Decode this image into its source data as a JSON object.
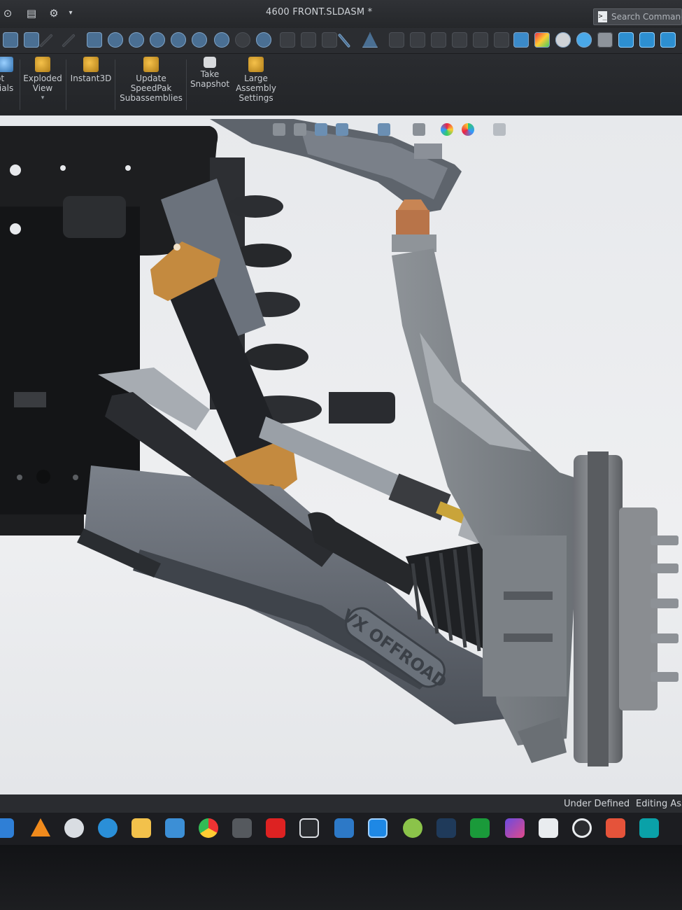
{
  "window": {
    "title": "4600 FRONT.SLDASM *",
    "search_placeholder": "Search Commands"
  },
  "ribbon": {
    "items": [
      {
        "label": "ot\nrials",
        "icon": "bill-of-materials-icon"
      },
      {
        "label": "Exploded\nView",
        "icon": "exploded-view-icon"
      },
      {
        "label": "Instant3D",
        "icon": "instant3d-icon"
      },
      {
        "label": "Update\nSpeedPak\nSubassemblies",
        "icon": "speedpak-icon"
      },
      {
        "label": "Take\nSnapshot",
        "icon": "camera-icon"
      },
      {
        "label": "Large\nAssembly\nSettings",
        "icon": "large-assembly-icon"
      }
    ]
  },
  "model": {
    "engraving": "VX OFFROAD"
  },
  "status": {
    "definition": "Under Defined",
    "mode": "Editing Ass"
  },
  "colors": {
    "background": "#e7e9ec",
    "frame": "#1d1e20",
    "arm": "#5f6670",
    "bracket": "#c48a3f",
    "strap": "#202226",
    "brass": "#c9a43a",
    "copper": "#c88554"
  },
  "taskbar": {
    "apps": [
      "windows-grid-icon",
      "vlc-icon",
      "ccleaner-icon",
      "remote-icon",
      "file-explorer-icon",
      "steam-icon",
      "chrome-icon",
      "game-icon",
      "autodesk-icon",
      "lightburn-icon",
      "folder-sync-icon",
      "cura-icon",
      "cloud-icon",
      "terminal-icon",
      "xbox-icon",
      "photo-icon",
      "cricut-icon",
      "record-icon",
      "security-icon",
      "arduino-icon"
    ]
  }
}
